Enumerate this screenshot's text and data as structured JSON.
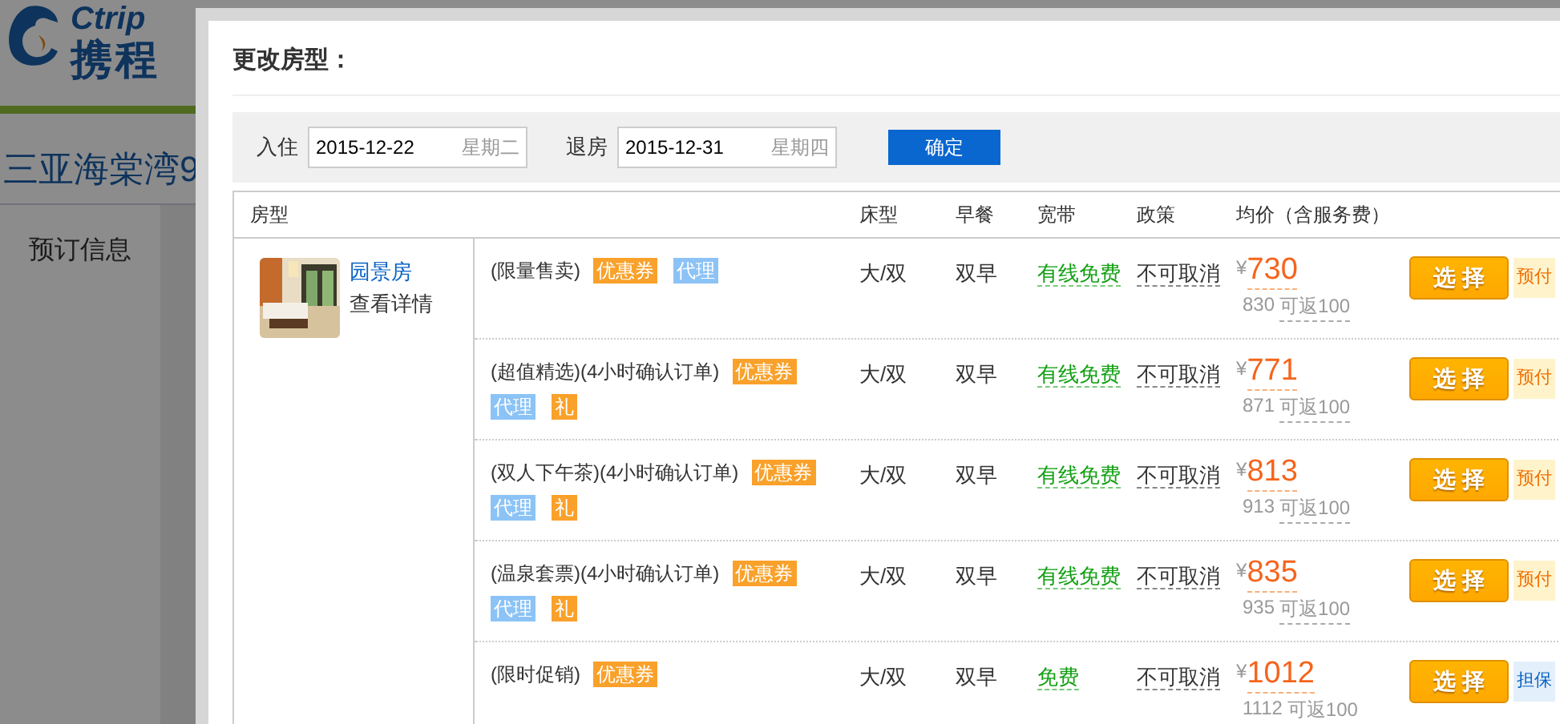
{
  "background": {
    "logo": {
      "latin": "Ctrip",
      "chinese": "携程"
    },
    "hotel_title": "三亚海棠湾9",
    "nav_item": "预订信息"
  },
  "modal": {
    "title": "更改房型：",
    "checkin": {
      "label": "入住",
      "date": "2015-12-22",
      "weekday": "星期二"
    },
    "checkout": {
      "label": "退房",
      "date": "2015-12-31",
      "weekday": "星期四"
    },
    "confirm_button": "确定",
    "table": {
      "columns": [
        "房型",
        "床型",
        "早餐",
        "宽带",
        "政策",
        "均价（含服务费）"
      ],
      "room": {
        "name": "园景房",
        "details_link": "查看详情"
      },
      "rows": [
        {
          "plan": "(限量售卖)",
          "tags": [
            {
              "label": "优惠券",
              "kind": "coupon"
            },
            {
              "label": "代理",
              "kind": "agent"
            }
          ],
          "bed": "大/双",
          "breakfast": "双早",
          "broadband": "有线免费",
          "policy": "不可取消",
          "currency": "¥",
          "price": "730",
          "original_price": "830",
          "cashback": "可返100",
          "button": "选 择",
          "payment": {
            "label": "预付",
            "kind": "prepay"
          }
        },
        {
          "plan": "(超值精选)(4小时确认订单)",
          "tags": [
            {
              "label": "优惠券",
              "kind": "coupon"
            },
            {
              "label": "代理",
              "kind": "agent"
            },
            {
              "label": "礼",
              "kind": "gift"
            }
          ],
          "bed": "大/双",
          "breakfast": "双早",
          "broadband": "有线免费",
          "policy": "不可取消",
          "currency": "¥",
          "price": "771",
          "original_price": "871",
          "cashback": "可返100",
          "button": "选 择",
          "payment": {
            "label": "预付",
            "kind": "prepay"
          }
        },
        {
          "plan": "(双人下午茶)(4小时确认订单)",
          "tags": [
            {
              "label": "优惠券",
              "kind": "coupon"
            },
            {
              "label": "代理",
              "kind": "agent"
            },
            {
              "label": "礼",
              "kind": "gift"
            }
          ],
          "bed": "大/双",
          "breakfast": "双早",
          "broadband": "有线免费",
          "policy": "不可取消",
          "currency": "¥",
          "price": "813",
          "original_price": "913",
          "cashback": "可返100",
          "button": "选 择",
          "payment": {
            "label": "预付",
            "kind": "prepay"
          }
        },
        {
          "plan": "(温泉套票)(4小时确认订单)",
          "tags": [
            {
              "label": "优惠券",
              "kind": "coupon"
            },
            {
              "label": "代理",
              "kind": "agent"
            },
            {
              "label": "礼",
              "kind": "gift"
            }
          ],
          "bed": "大/双",
          "breakfast": "双早",
          "broadband": "有线免费",
          "policy": "不可取消",
          "currency": "¥",
          "price": "835",
          "original_price": "935",
          "cashback": "可返100",
          "button": "选 择",
          "payment": {
            "label": "预付",
            "kind": "prepay"
          }
        },
        {
          "plan": "(限时促销)",
          "tags": [
            {
              "label": "优惠券",
              "kind": "coupon"
            }
          ],
          "bed": "大/双",
          "breakfast": "双早",
          "broadband": "免费",
          "policy": "不可取消",
          "currency": "¥",
          "price": "1012",
          "original_price": "1112",
          "cashback": "可返100",
          "button": "选 择",
          "payment": {
            "label": "担保",
            "kind": "guarantee"
          }
        }
      ]
    }
  }
}
